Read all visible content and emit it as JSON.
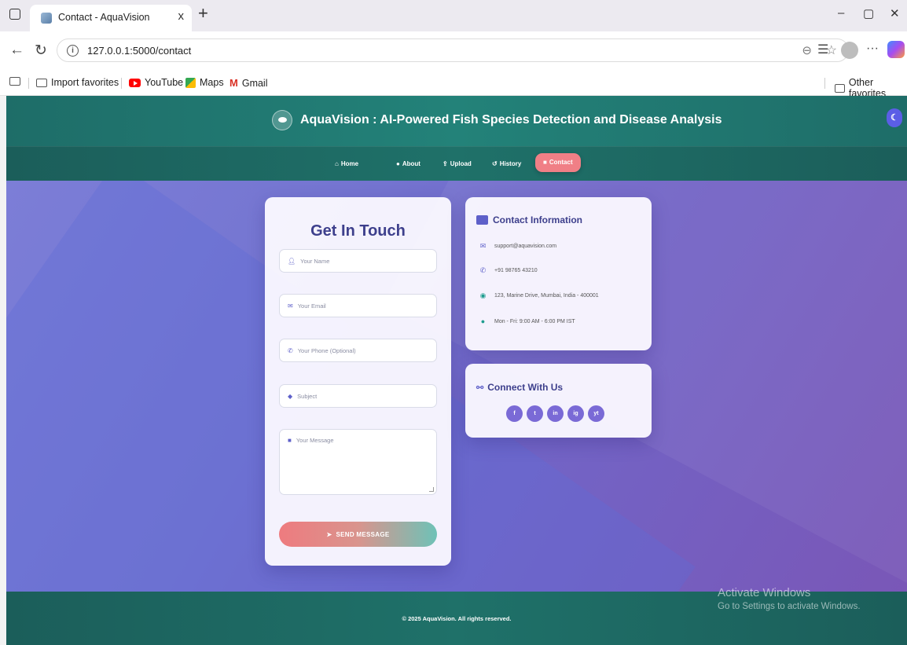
{
  "browser": {
    "tab_title": "Contact - AquaVision",
    "tab_close": "x",
    "new_tab": "+",
    "url": "127.0.0.1:5000/contact",
    "bookmarks": {
      "import": "Import favorites",
      "youtube": "YouTube",
      "maps": "Maps",
      "gmail": "Gmail",
      "other": "Other favorites"
    }
  },
  "header": {
    "title": "AquaVision : AI-Powered Fish Species Detection and Disease Analysis",
    "theme_toggle": "☾"
  },
  "nav": {
    "items": [
      {
        "label": "Home",
        "icon": "home-icon"
      },
      {
        "label": "About",
        "icon": "info-icon"
      },
      {
        "label": "Upload",
        "icon": "upload-icon"
      },
      {
        "label": "History",
        "icon": "history-icon"
      },
      {
        "label": "Contact",
        "icon": "envelope-icon",
        "active": true
      }
    ]
  },
  "form": {
    "title": "Get In Touch",
    "name_placeholder": "Your Name",
    "email_placeholder": "Your Email",
    "phone_placeholder": "Your Phone (Optional)",
    "subject_placeholder": "Subject",
    "message_placeholder": "Your Message",
    "send_label": "SEND MESSAGE"
  },
  "contact_info": {
    "title": "Contact Information",
    "email": "support@aquavision.com",
    "phone": "+91 98765 43210",
    "address": "123, Marine Drive, Mumbai, India - 400001",
    "hours": "Mon - Fri: 9:00 AM - 6:00 PM IST"
  },
  "connect": {
    "title": "Connect With Us",
    "socials": [
      {
        "label": "f",
        "icon": "facebook-icon"
      },
      {
        "label": "t",
        "icon": "twitter-icon"
      },
      {
        "label": "in",
        "icon": "linkedin-icon"
      },
      {
        "label": "ig",
        "icon": "instagram-icon"
      },
      {
        "label": "yt",
        "icon": "youtube-icon"
      }
    ]
  },
  "footer": {
    "text": "© 2025 AquaVision. All rights reserved."
  },
  "windows": {
    "line1": "Activate Windows",
    "line2": "Go to Settings to activate Windows."
  },
  "colors": {
    "header_teal": "#238279",
    "accent_purple": "#5e60c9",
    "active_nav": "#f07f86"
  }
}
